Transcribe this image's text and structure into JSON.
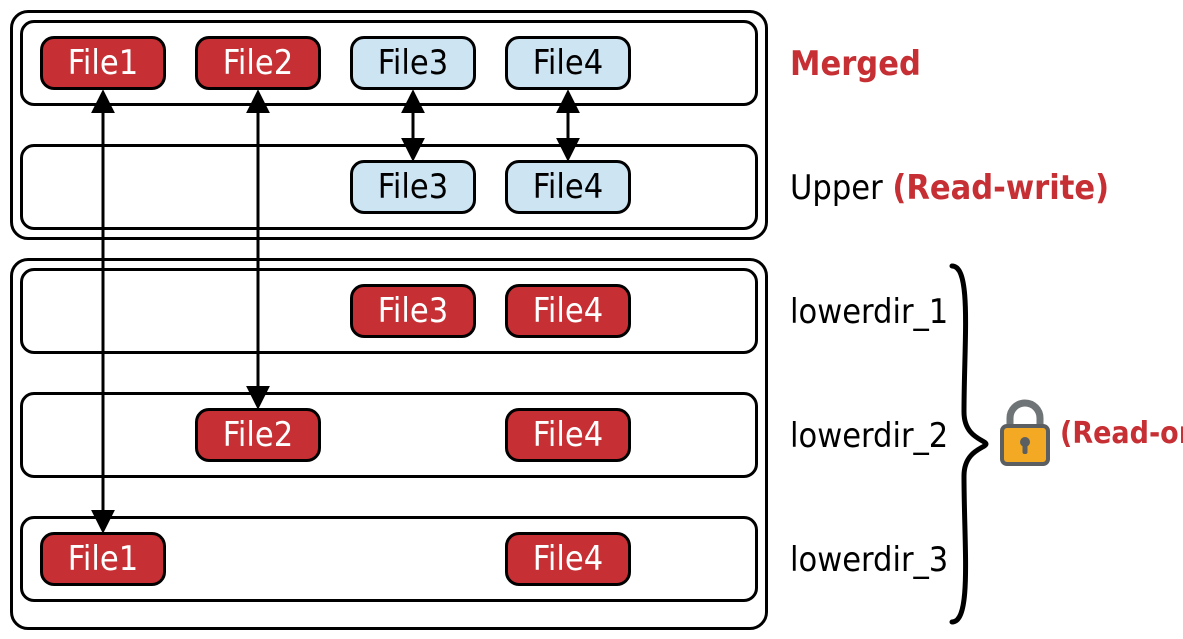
{
  "files": {
    "f1": "File1",
    "f2": "File2",
    "f3": "File3",
    "f4": "File4"
  },
  "labels": {
    "merged": "Merged",
    "upper_prefix": "Upper ",
    "upper_suffix": "(Read-write)",
    "lower1": "lowerdir_1",
    "lower2": "lowerdir_2",
    "lower3": "lowerdir_3",
    "readonly": "(Read-only)"
  },
  "icons": {
    "lock": "lock-icon"
  },
  "layers": [
    {
      "name": "Merged",
      "files": [
        "File1",
        "File2",
        "File3",
        "File4"
      ],
      "access": "merged"
    },
    {
      "name": "Upper",
      "files": [
        "File3",
        "File4"
      ],
      "access": "read-write"
    },
    {
      "name": "lowerdir_1",
      "files": [
        "File3",
        "File4"
      ],
      "access": "read-only"
    },
    {
      "name": "lowerdir_2",
      "files": [
        "File2",
        "File4"
      ],
      "access": "read-only"
    },
    {
      "name": "lowerdir_3",
      "files": [
        "File1",
        "File4"
      ],
      "access": "read-only"
    }
  ],
  "links": [
    {
      "file": "File1",
      "from": "Merged",
      "to": "lowerdir_3"
    },
    {
      "file": "File2",
      "from": "Merged",
      "to": "lowerdir_2"
    },
    {
      "file": "File3",
      "from": "Merged",
      "to": "Upper"
    },
    {
      "file": "File4",
      "from": "Merged",
      "to": "Upper"
    }
  ]
}
